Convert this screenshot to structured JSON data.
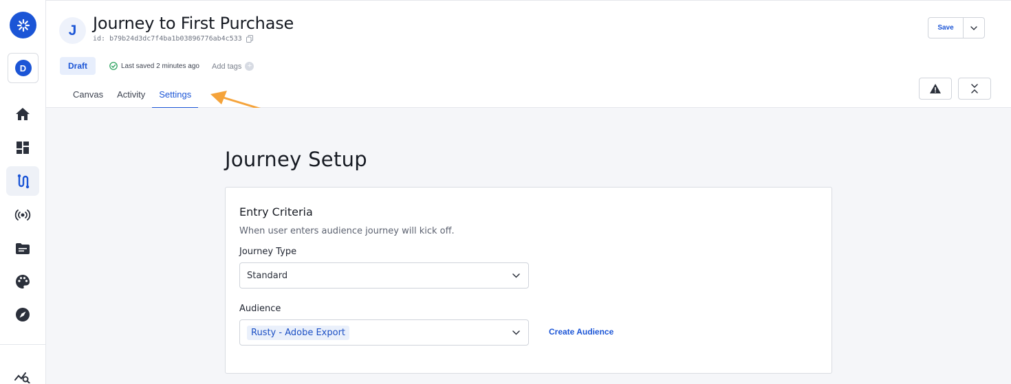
{
  "header": {
    "avatar_letter": "J",
    "title": "Journey to First Purchase",
    "id_label": "id: b79b24d3dc7f4ba1b03896776ab4c533",
    "status_badge": "Draft",
    "last_saved": "Last saved 2 minutes ago",
    "add_tags": "Add tags",
    "save_label": "Save"
  },
  "sidebar": {
    "user_initial": "D",
    "items": [
      {
        "icon": "home-icon"
      },
      {
        "icon": "dashboard-icon"
      },
      {
        "icon": "journey-icon",
        "active": true
      },
      {
        "icon": "broadcast-icon"
      },
      {
        "icon": "folder-icon"
      },
      {
        "icon": "palette-icon"
      },
      {
        "icon": "compass-icon"
      },
      {
        "icon": "analytics-search-icon"
      }
    ]
  },
  "tabs": [
    {
      "label": "Canvas"
    },
    {
      "label": "Activity"
    },
    {
      "label": "Settings",
      "active": true
    }
  ],
  "main": {
    "section_title": "Journey Setup",
    "card": {
      "title": "Entry Criteria",
      "description": "When user enters audience journey will kick off.",
      "journey_type_label": "Journey Type",
      "journey_type_value": "Standard",
      "audience_label": "Audience",
      "audience_value": "Rusty - Adobe Export",
      "create_audience": "Create Audience"
    }
  },
  "colors": {
    "accent": "#1b55d6",
    "annotation_arrow": "#f5a33a",
    "success": "#1f9d55"
  }
}
